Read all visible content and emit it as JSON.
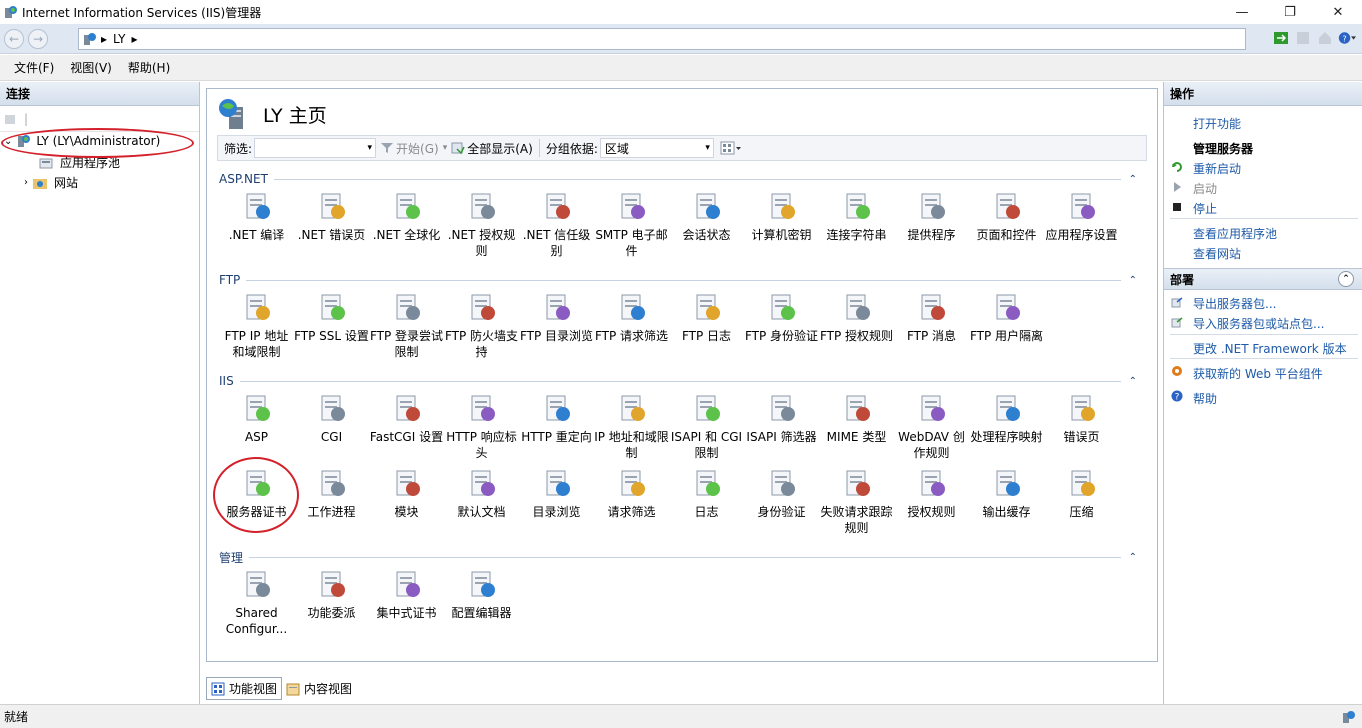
{
  "window": {
    "title": "Internet Information Services (IIS)管理器"
  },
  "address": {
    "segments": [
      "LY"
    ]
  },
  "menu": [
    "文件(F)",
    "视图(V)",
    "帮助(H)"
  ],
  "connections": {
    "header": "连接",
    "root": "LY (LY\\Administrator)",
    "children": [
      "应用程序池",
      "网站"
    ]
  },
  "main": {
    "title": "LY 主页",
    "filter_label": "筛选:",
    "go_label": "开始(G)",
    "show_all_label": "全部显示(A)",
    "group_by_label": "分组依据:",
    "group_by_value": "区域",
    "groups": [
      {
        "name": "ASP.NET",
        "items": [
          ".NET 编译",
          ".NET 错误页",
          ".NET 全球化",
          ".NET 授权规则",
          ".NET 信任级别",
          "SMTP 电子邮件",
          "会话状态",
          "计算机密钥",
          "连接字符串",
          "提供程序",
          "页面和控件",
          "应用程序设置"
        ]
      },
      {
        "name": "FTP",
        "items": [
          "FTP IP 地址和域限制",
          "FTP SSL 设置",
          "FTP 登录尝试限制",
          "FTP 防火墙支持",
          "FTP 目录浏览",
          "FTP 请求筛选",
          "FTP 日志",
          "FTP 身份验证",
          "FTP 授权规则",
          "FTP 消息",
          "FTP 用户隔离"
        ]
      },
      {
        "name": "IIS",
        "items": [
          "ASP",
          "CGI",
          "FastCGI 设置",
          "HTTP 响应标头",
          "HTTP 重定向",
          "IP 地址和域限制",
          "ISAPI 和 CGI 限制",
          "ISAPI 筛选器",
          "MIME 类型",
          "WebDAV 创作规则",
          "处理程序映射",
          "错误页",
          "服务器证书",
          "工作进程",
          "模块",
          "默认文档",
          "目录浏览",
          "请求筛选",
          "日志",
          "身份验证",
          "失败请求跟踪规则",
          "授权规则",
          "输出缓存",
          "压缩"
        ]
      },
      {
        "name": "管理",
        "items": [
          "Shared Configur...",
          "功能委派",
          "集中式证书",
          "配置编辑器"
        ]
      }
    ]
  },
  "view_tabs": [
    "功能视图",
    "内容视图"
  ],
  "actions": {
    "header": "操作",
    "open_feature": "打开功能",
    "manage_server_header": "管理服务器",
    "restart": "重新启动",
    "start": "启动",
    "stop": "停止",
    "view_app_pools": "查看应用程序池",
    "view_sites": "查看网站",
    "deploy_header": "部署",
    "export_pkg": "导出服务器包...",
    "import_pkg": "导入服务器包或站点包...",
    "change_net": "更改 .NET Framework 版本",
    "get_web_platform": "获取新的 Web 平台组件",
    "help": "帮助"
  },
  "status": {
    "text": "就绪"
  },
  "colors": {
    "accent": "#1e5aa8",
    "highlight": "#d3202a",
    "group_header": "#1f3f71"
  }
}
